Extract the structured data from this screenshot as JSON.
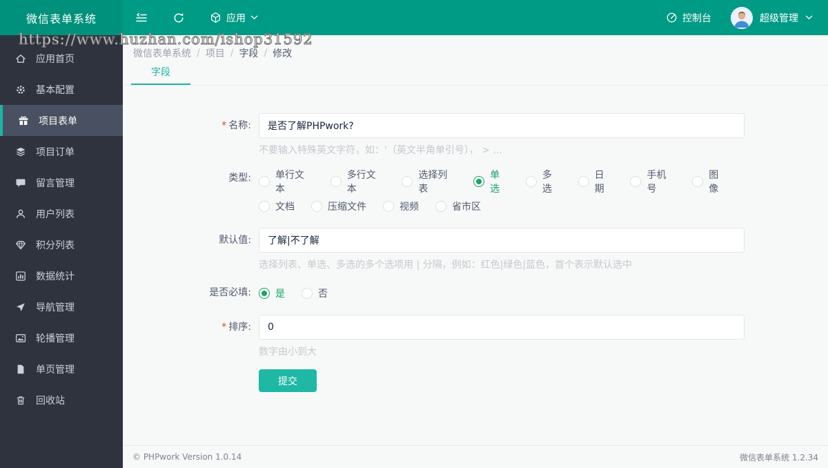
{
  "topbar": {
    "title": "微信表单系统",
    "app_menu": "应用",
    "console": "控制台",
    "user": "超级管理"
  },
  "watermark": "https://www.huzhan.com/ishop31592",
  "sidebar": {
    "items": [
      {
        "label": "应用首页",
        "icon": "home-icon"
      },
      {
        "label": "基本配置",
        "icon": "gear-icon"
      },
      {
        "label": "项目表单",
        "icon": "gift-icon",
        "active": true
      },
      {
        "label": "项目订单",
        "icon": "layers-icon"
      },
      {
        "label": "留言管理",
        "icon": "comment-icon"
      },
      {
        "label": "用户列表",
        "icon": "user-icon"
      },
      {
        "label": "积分列表",
        "icon": "gem-icon"
      },
      {
        "label": "数据统计",
        "icon": "chart-icon"
      },
      {
        "label": "导航管理",
        "icon": "navigation-icon"
      },
      {
        "label": "轮播管理",
        "icon": "image-icon"
      },
      {
        "label": "单页管理",
        "icon": "page-icon"
      },
      {
        "label": "回收站",
        "icon": "trash-icon"
      }
    ]
  },
  "breadcrumb": {
    "items": [
      "微信表单系统",
      "项目",
      "字段",
      "修改"
    ],
    "separator": "/"
  },
  "tabs": {
    "active": "字段"
  },
  "form": {
    "required_mark": "*",
    "name": {
      "label": "名称:",
      "value": "是否了解PHPwork?",
      "helper": "不要输入特殊英文字符，如：'（英文半角单引号）， > ..."
    },
    "type": {
      "label": "类型:",
      "options": [
        {
          "label": "单行文本",
          "selected": false
        },
        {
          "label": "多行文本",
          "selected": false
        },
        {
          "label": "选择列表",
          "selected": false
        },
        {
          "label": "单选",
          "selected": true
        },
        {
          "label": "多选",
          "selected": false
        },
        {
          "label": "日期",
          "selected": false
        },
        {
          "label": "手机号",
          "selected": false
        },
        {
          "label": "图像",
          "selected": false
        },
        {
          "label": "文档",
          "selected": false
        },
        {
          "label": "压缩文件",
          "selected": false
        },
        {
          "label": "视频",
          "selected": false
        },
        {
          "label": "省市区",
          "selected": false
        }
      ]
    },
    "default": {
      "label": "默认值:",
      "value": "了解|不了解",
      "helper": "选择列表、单选、多选的多个选项用 | 分隔，例如：红色|绿色|蓝色，首个表示默认选中"
    },
    "required": {
      "label": "是否必填:",
      "options": [
        {
          "label": "是",
          "selected": true
        },
        {
          "label": "否",
          "selected": false
        }
      ]
    },
    "sort": {
      "label": "排序:",
      "value": "0",
      "helper": "数字由小到大"
    },
    "submit": "提交"
  },
  "footer": {
    "left": "© PHPwork Version 1.0.14",
    "right": "微信表单系统 1.2.34"
  },
  "colors": {
    "topbar": "#009b85",
    "logo_area": "#00917c",
    "sidebar": "#2e333e",
    "sidebar_active": "#495061",
    "accent_teal": "#1cb5a3",
    "radio_green": "#18a564",
    "required_red": "#ed4014"
  }
}
